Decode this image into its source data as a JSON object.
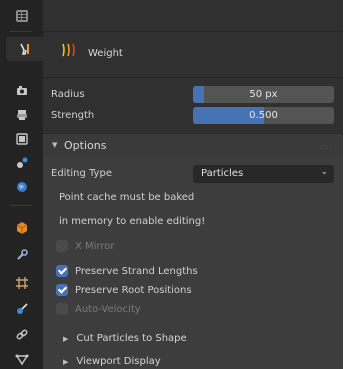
{
  "tool": {
    "icon": "hair-strands-icon",
    "name": "Weight"
  },
  "settings": {
    "radius": {
      "label": "Radius",
      "value": "50 px",
      "fill": 0.08
    },
    "strength": {
      "label": "Strength",
      "value": "0.500",
      "fill": 0.5
    }
  },
  "options_panel": {
    "title": "Options",
    "editing_type": {
      "label": "Editing Type",
      "value": "Particles"
    },
    "message_line1": "Point cache must be baked",
    "message_line2": "in memory to enable editing!",
    "x_mirror": "X Mirror",
    "preserve_strand_lengths": "Preserve Strand Lengths",
    "preserve_root_positions": "Preserve Root Positions",
    "auto_velocity": "Auto-Velocity"
  },
  "subpanels": {
    "cut_particles": "Cut Particles to Shape",
    "viewport_display": "Viewport Display"
  },
  "colors": {
    "accent": "#4772b3",
    "panel_bg": "#3d3d3d",
    "header_bg": "#303030",
    "tab_bg": "#232323"
  }
}
